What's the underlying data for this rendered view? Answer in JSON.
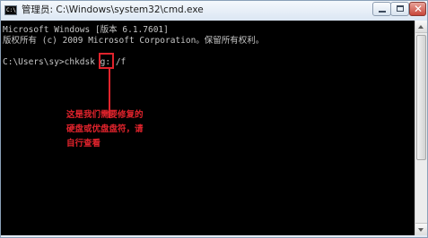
{
  "window": {
    "title": "管理员: C:\\Windows\\system32\\cmd.exe",
    "icon": "console-app-icon",
    "icon_text": "C:\\",
    "buttons": {
      "minimize_icon": "minimize-icon",
      "maximize_icon": "maximize-icon",
      "close_icon": "close-icon",
      "close_glyph": "✕"
    }
  },
  "console": {
    "lines": [
      "Microsoft Windows [版本 6.1.7601]",
      "版权所有 (c) 2009 Microsoft Corporation。保留所有权利。",
      "C:\\Users\\sy>chkdsk g: /f"
    ],
    "text_color": "#c6c6c6",
    "background": "#000000"
  },
  "annotation": {
    "lines": [
      "这是我们需要修复的",
      "硬盘或优盘盘符，请",
      "自行查看"
    ],
    "color": "#e0232c",
    "target": "g:"
  }
}
